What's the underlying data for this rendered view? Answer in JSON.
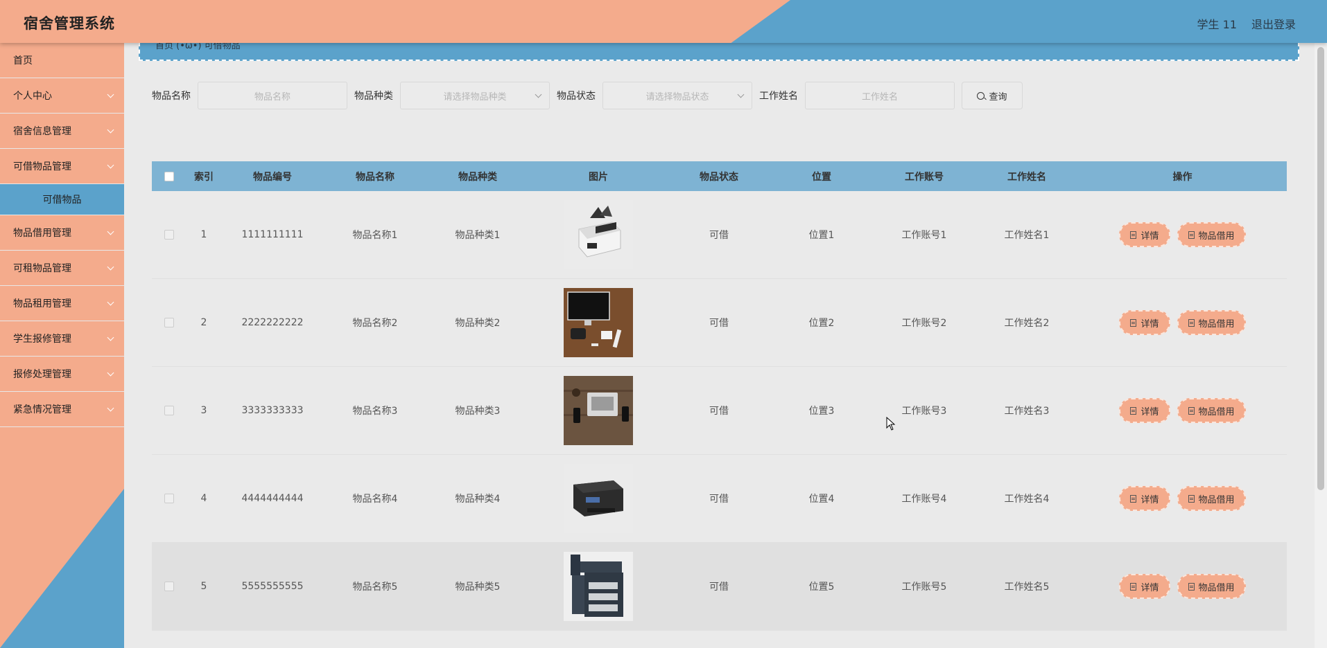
{
  "header": {
    "app_title": "宿舍管理系统",
    "user_label": "学生 11",
    "logout_label": "退出登录"
  },
  "sidebar": {
    "items": [
      {
        "label": "首页",
        "has_children": false
      },
      {
        "label": "个人中心",
        "has_children": true
      },
      {
        "label": "宿舍信息管理",
        "has_children": true
      },
      {
        "label": "可借物品管理",
        "has_children": true
      },
      {
        "label": "物品借用管理",
        "has_children": true
      },
      {
        "label": "可租物品管理",
        "has_children": true
      },
      {
        "label": "物品租用管理",
        "has_children": true
      },
      {
        "label": "学生报修管理",
        "has_children": true
      },
      {
        "label": "报修处理管理",
        "has_children": true
      },
      {
        "label": "紧急情况管理",
        "has_children": true
      }
    ],
    "active_sub": "可借物品"
  },
  "breadcrumb": {
    "text": "首页 (•ω•) 可借物品"
  },
  "search": {
    "name_label": "物品名称",
    "name_placeholder": "物品名称",
    "type_label": "物品种类",
    "type_placeholder": "请选择物品种类",
    "status_label": "物品状态",
    "status_placeholder": "请选择物品状态",
    "worker_label": "工作姓名",
    "worker_placeholder": "工作姓名",
    "query_button": "查询"
  },
  "table": {
    "columns": [
      "索引",
      "物品编号",
      "物品名称",
      "物品种类",
      "图片",
      "物品状态",
      "位置",
      "工作账号",
      "工作姓名",
      "操作"
    ],
    "rows": [
      {
        "index": "1",
        "code": "1111111111",
        "name": "物品名称1",
        "type": "物品种类1",
        "image": "money-counter",
        "status": "可借",
        "position": "位置1",
        "account": "工作账号1",
        "worker": "工作姓名1"
      },
      {
        "index": "2",
        "code": "2222222222",
        "name": "物品名称2",
        "type": "物品种类2",
        "image": "desk-monitor",
        "status": "可借",
        "position": "位置2",
        "account": "工作账号2",
        "worker": "工作姓名2"
      },
      {
        "index": "3",
        "code": "3333333333",
        "name": "物品名称3",
        "type": "物品种类3",
        "image": "laptop-desk",
        "status": "可借",
        "position": "位置3",
        "account": "工作账号3",
        "worker": "工作姓名3"
      },
      {
        "index": "4",
        "code": "4444444444",
        "name": "物品名称4",
        "type": "物品种类4",
        "image": "printer",
        "status": "可借",
        "position": "位置4",
        "account": "工作账号4",
        "worker": "工作姓名4"
      },
      {
        "index": "5",
        "code": "5555555555",
        "name": "物品名称5",
        "type": "物品种类5",
        "image": "copier",
        "status": "可借",
        "position": "位置5",
        "account": "工作账号5",
        "worker": "工作姓名5"
      }
    ],
    "detail_label": "详情",
    "borrow_label": "物品借用"
  },
  "colors": {
    "accent_orange": "#f4ab8c",
    "accent_blue": "#5ba2cb",
    "table_header": "#7eb3d3"
  }
}
